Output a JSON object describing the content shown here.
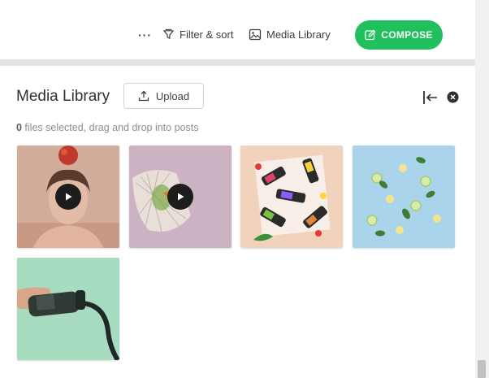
{
  "toolbar": {
    "more_label": "···",
    "filter_label": "Filter & sort",
    "media_label": "Media Library",
    "compose_label": "COMPOSE"
  },
  "panel": {
    "title": "Media Library",
    "upload_label": "Upload",
    "selected_count": "0",
    "status_text": " files selected, drag and drop into posts"
  },
  "colors": {
    "compose": "#20c05c",
    "divider": "#e2e3e5"
  },
  "media": [
    {
      "kind": "video",
      "icon": "play-icon"
    },
    {
      "kind": "video",
      "icon": "play-icon"
    },
    {
      "kind": "image"
    },
    {
      "kind": "image"
    },
    {
      "kind": "image"
    }
  ]
}
